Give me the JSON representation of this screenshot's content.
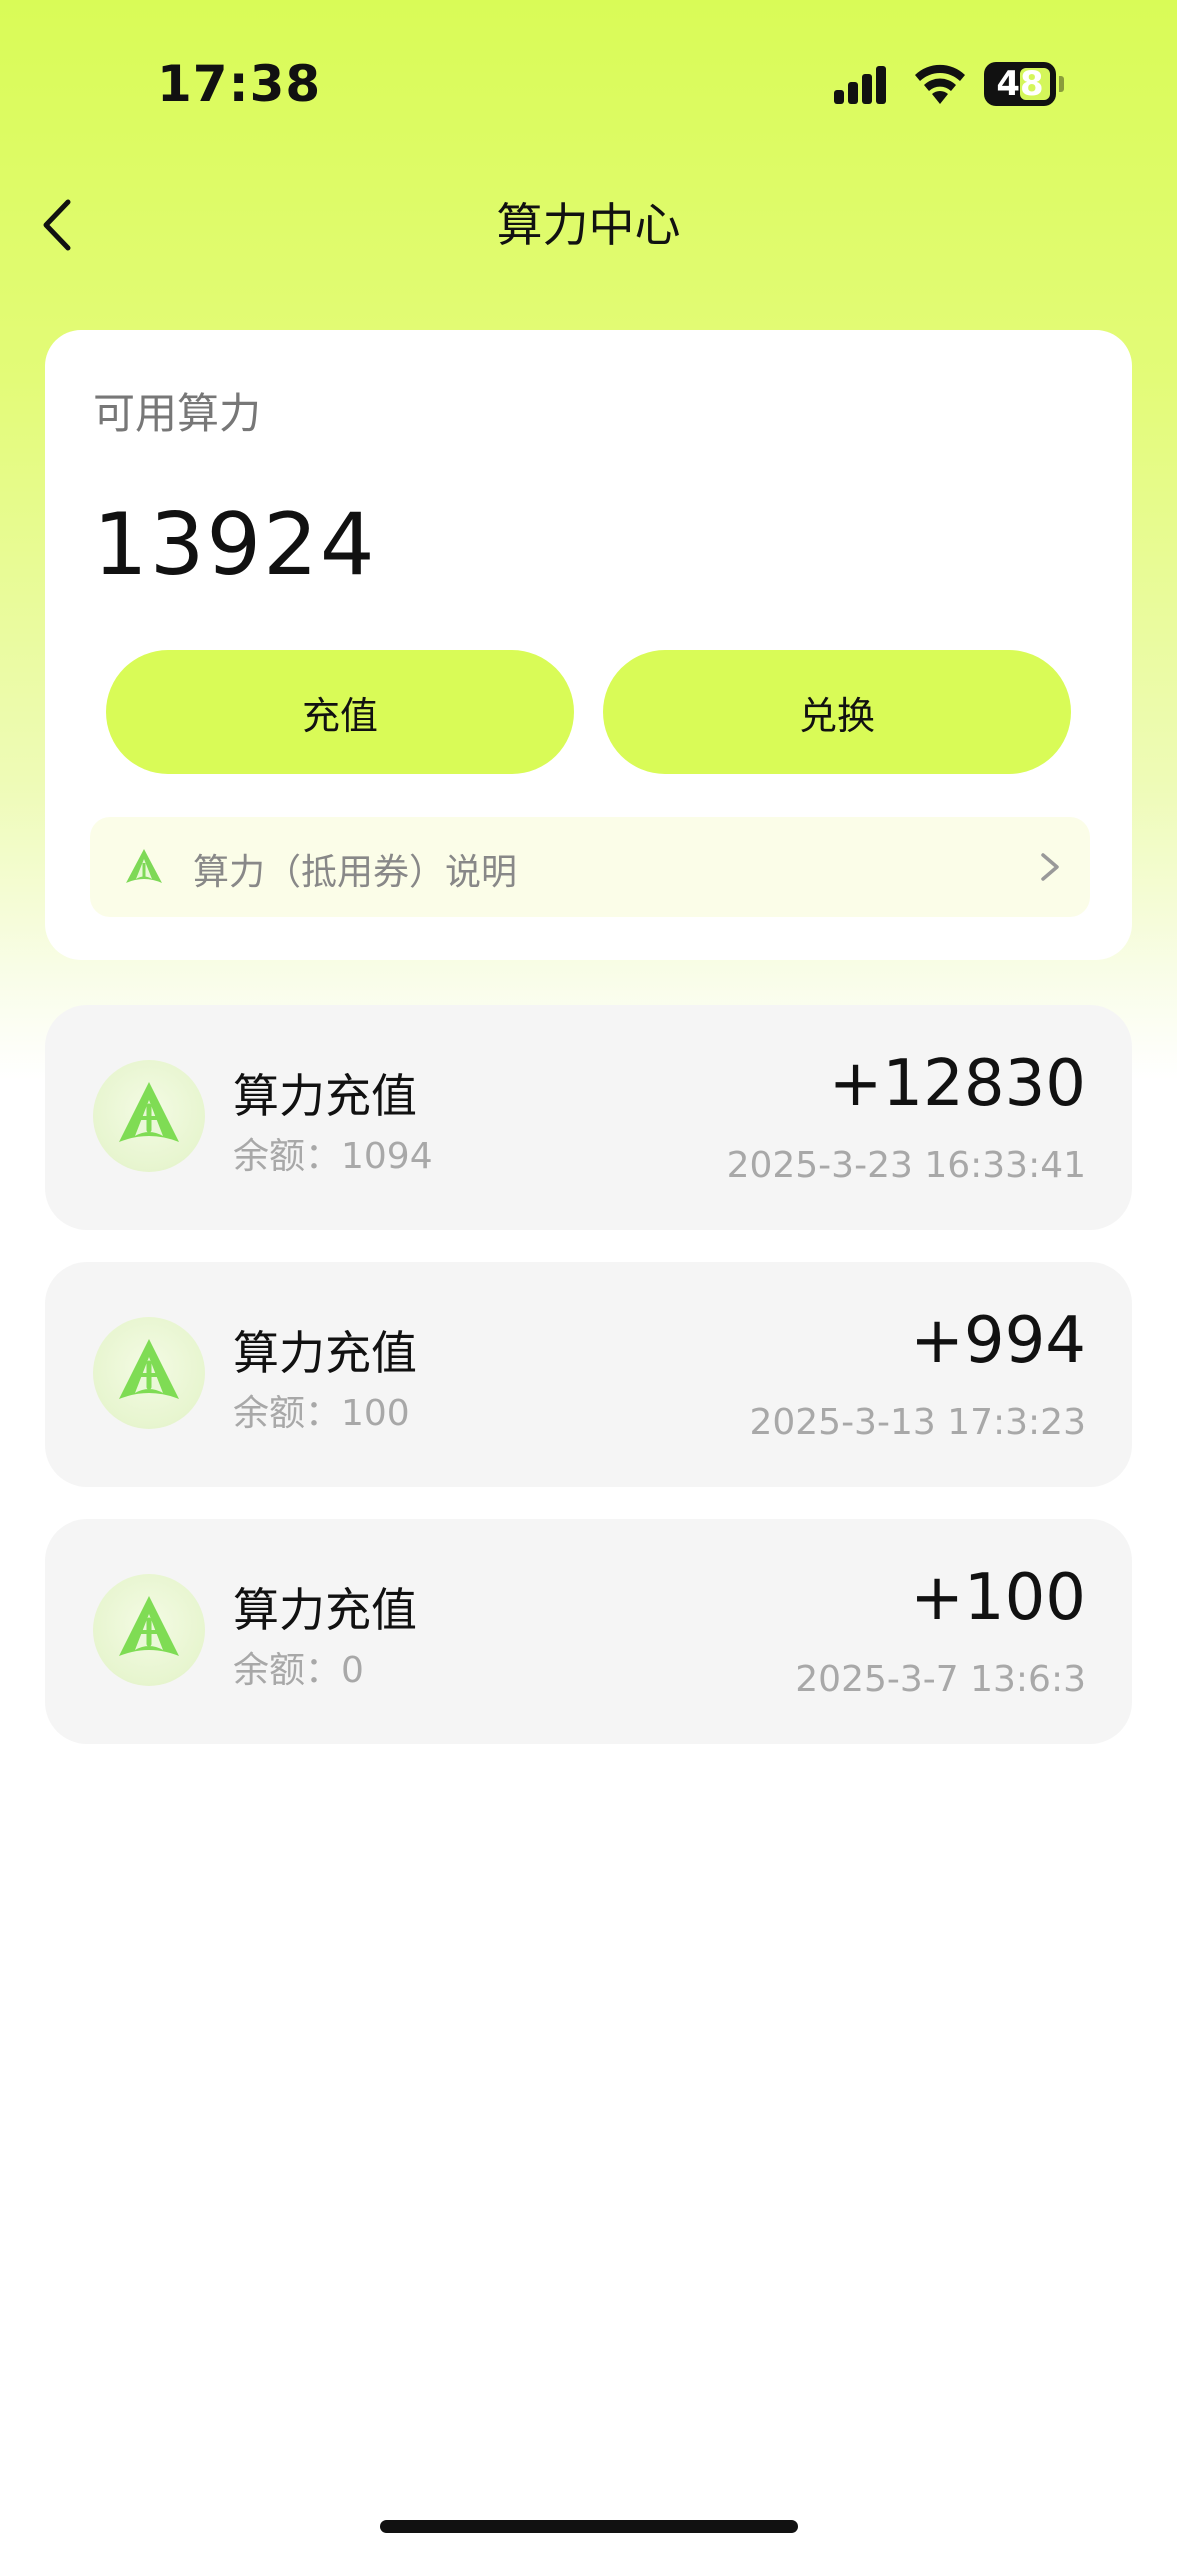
{
  "status_bar": {
    "time": "17:38",
    "battery": "48"
  },
  "header": {
    "title": "算力中心"
  },
  "summary": {
    "label": "可用算力",
    "value": "13924",
    "recharge_label": "充值",
    "exchange_label": "兑换",
    "info_text": "算力（抵用券）说明"
  },
  "transactions": [
    {
      "title": "算力充值",
      "balance": "余额：1094",
      "amount": "+12830",
      "date": "2025-3-23 16:33:41"
    },
    {
      "title": "算力充值",
      "balance": "余额：100",
      "amount": "+994",
      "date": "2025-3-13 17:3:23"
    },
    {
      "title": "算力充值",
      "balance": "余额：0",
      "amount": "+100",
      "date": "2025-3-7 13:6:3"
    }
  ],
  "colors": {
    "accent": "#d9fb57",
    "card": "#ffffff",
    "row": "#f5f5f5"
  },
  "icons": [
    "back-chevron-icon",
    "signal-icon",
    "wifi-icon",
    "battery-icon",
    "logo-icon",
    "chevron-right-icon"
  ]
}
